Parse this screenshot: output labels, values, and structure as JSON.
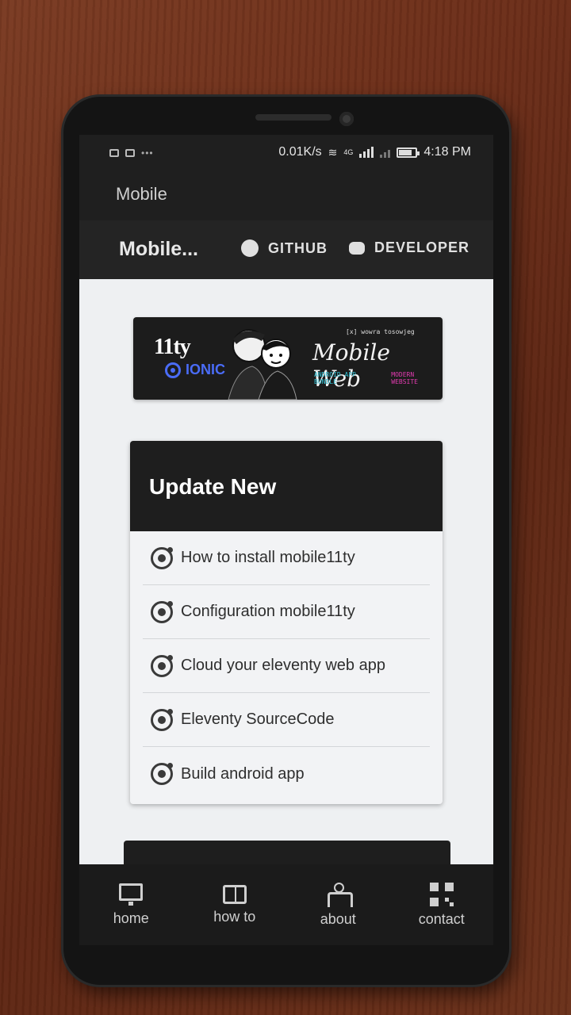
{
  "status_bar": {
    "speed": "0.01K/s",
    "network": "4G",
    "time": "4:18 PM"
  },
  "app_bar": {
    "title": "Mobile"
  },
  "toolbar": {
    "title": "Mobile...",
    "github_label": "GITHUB",
    "developer_label": "DEVELOPER"
  },
  "banner": {
    "logo_text": "11ty",
    "ionic_text": "IONIC",
    "small_text": "[x] wowra tosowjeg",
    "headline": "Mobile Web",
    "sub_a": "ANDROID APP BUNDLE",
    "sub_b": "MODERN WEBSITE",
    "colors": {
      "ionic": "#4a6cf7",
      "sub_a": "#33c3d6",
      "sub_b": "#e23bb0"
    }
  },
  "card": {
    "header": "Update New",
    "items": [
      {
        "label": "How to install mobile11ty",
        "icon": "ionic-icon"
      },
      {
        "label": "Configuration mobile11ty",
        "icon": "ionic-icon"
      },
      {
        "label": "Cloud your eleventy web app",
        "icon": "ionic-icon"
      },
      {
        "label": "Eleventy SourceCode",
        "icon": "ionic-icon"
      },
      {
        "label": "Build android app",
        "icon": "ionic-icon"
      }
    ]
  },
  "tabs": [
    {
      "label": "home",
      "icon": "monitor-icon"
    },
    {
      "label": "how to",
      "icon": "book-icon"
    },
    {
      "label": "about",
      "icon": "accessibility-icon"
    },
    {
      "label": "contact",
      "icon": "qr-code-icon"
    }
  ]
}
